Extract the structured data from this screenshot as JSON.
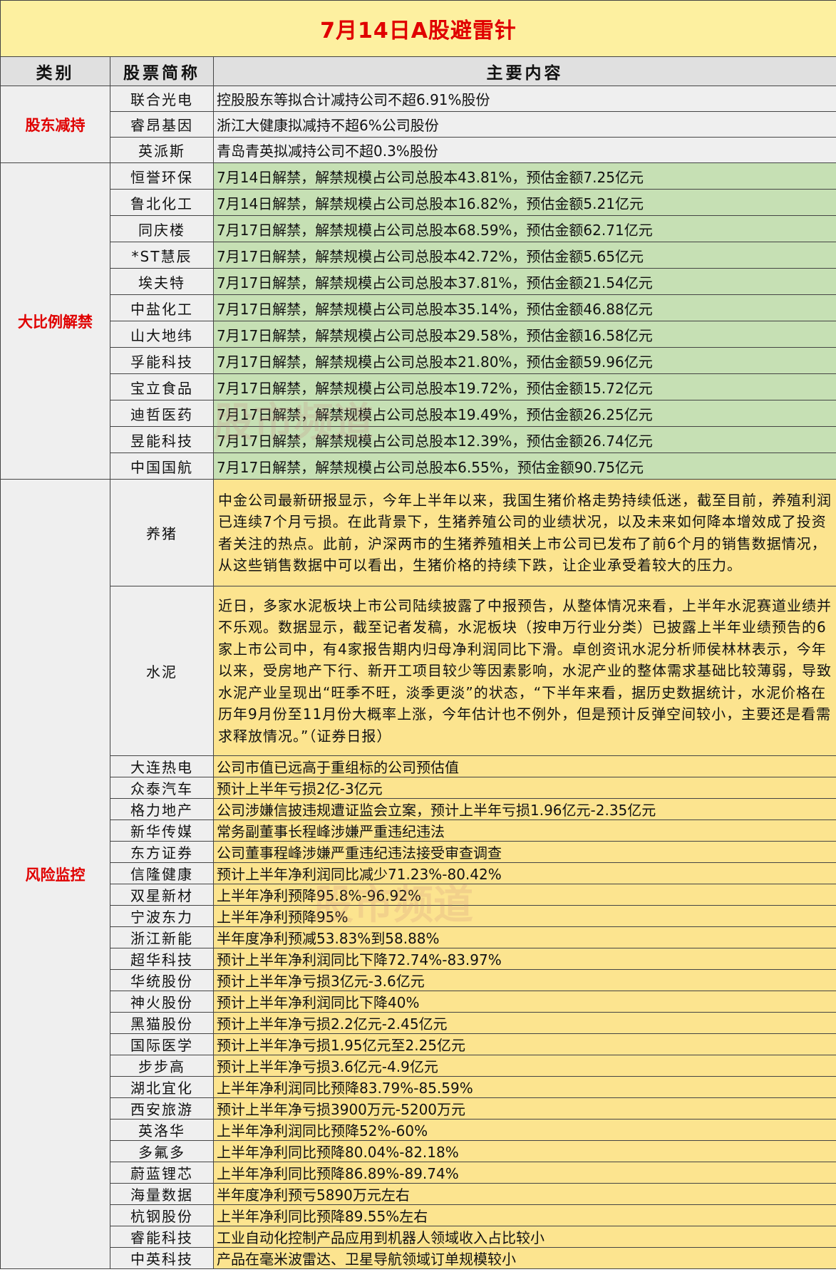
{
  "title": "7月14日A股避雷针",
  "headers": [
    "类别",
    "股票简称",
    "主要内容"
  ],
  "watermark": "股市频道",
  "groups": {
    "shareholder": {
      "category": "股东减持",
      "rows": [
        {
          "name": "联合光电",
          "content": "控股股东等拟合计减持公司不超6.91%股份"
        },
        {
          "name": "睿昂基因",
          "content": "浙江大健康拟减持不超6%公司股份"
        },
        {
          "name": "英派斯",
          "content": "青岛青英拟减持公司不超0.3%股份"
        }
      ]
    },
    "unlock": {
      "category": "大比例解禁",
      "rows": [
        {
          "name": "恒誉环保",
          "content": "7月14日解禁，解禁规模占公司总股本43.81%，预估金额7.25亿元"
        },
        {
          "name": "鲁北化工",
          "content": "7月14日解禁，解禁规模占公司总股本16.82%，预估金额5.21亿元"
        },
        {
          "name": "同庆楼",
          "content": "7月17日解禁，解禁规模占公司总股本68.59%，预估金额62.71亿元"
        },
        {
          "name": "*ST慧辰",
          "content": "7月17日解禁，解禁规模占公司总股本42.72%，预估金额5.65亿元"
        },
        {
          "name": "埃夫特",
          "content": "7月17日解禁，解禁规模占公司总股本37.81%，预估金额21.54亿元"
        },
        {
          "name": "中盐化工",
          "content": "7月17日解禁，解禁规模占公司总股本35.14%，预估金额46.88亿元"
        },
        {
          "name": "山大地纬",
          "content": "7月17日解禁，解禁规模占公司总股本29.58%，预估金额16.58亿元"
        },
        {
          "name": "孚能科技",
          "content": "7月17日解禁，解禁规模占公司总股本21.80%，预估金额59.96亿元"
        },
        {
          "name": "宝立食品",
          "content": "7月17日解禁，解禁规模占公司总股本19.72%，预估金额15.72亿元"
        },
        {
          "name": "迪哲医药",
          "content": "7月17日解禁，解禁规模占公司总股本19.49%，预估金额26.25亿元"
        },
        {
          "name": "昱能科技",
          "content": "7月17日解禁，解禁规模占公司总股本12.39%，预估金额26.74亿元"
        },
        {
          "name": "中国国航",
          "content": "7月17日解禁，解禁规模占公司总股本6.55%，预估金额90.75亿元"
        }
      ]
    },
    "risk": {
      "category": "风险监控",
      "rows": [
        {
          "name": "养猪",
          "content": "中金公司最新研报显示，今年上半年以来，我国生猪价格走势持续低迷，截至目前，养殖利润已连续7个月亏损。在此背景下，生猪养殖公司的业绩状况，以及未来如何降本增效成了投资者关注的热点。此前，沪深两市的生猪养殖相关上市公司已发布了前6个月的销售数据情况，从这些销售数据中可以看出，生猪价格的持续下跌，让企业承受着较大的压力。"
        },
        {
          "name": "水泥",
          "content": "近日，多家水泥板块上市公司陆续披露了中报预告，从整体情况来看，上半年水泥赛道业绩并不乐观。数据显示，截至记者发稿，水泥板块（按申万行业分类）已披露上半年业绩预告的6家上市公司中，有4家报告期内归母净利润同比下滑。卓创资讯水泥分析师侯林林表示，今年以来，受房地产下行、新开工项目较少等因素影响，水泥产业的整体需求基础比较薄弱，导致水泥产业呈现出“旺季不旺，淡季更淡”的状态，“下半年来看，据历史数据统计，水泥价格在历年9月份至11月份大概率上涨，今年估计也不例外，但是预计反弹空间较小，主要还是看需求释放情况。”（证券日报）"
        },
        {
          "name": "大连热电",
          "content": "公司市值已远高于重组标的公司预估值"
        },
        {
          "name": "众泰汽车",
          "content": "预计上半年亏损2亿-3亿元"
        },
        {
          "name": "格力地产",
          "content": "公司涉嫌信披违规遭证监会立案，预计上半年亏损1.96亿元-2.35亿元"
        },
        {
          "name": "新华传媒",
          "content": "常务副董事长程峰涉嫌严重违纪违法"
        },
        {
          "name": "东方证券",
          "content": "公司董事程峰涉嫌严重违纪违法接受审查调查"
        },
        {
          "name": "信隆健康",
          "content": "预计上半年净利润同比减少71.23%-80.42%"
        },
        {
          "name": "双星新材",
          "content": "上半年净利预降95.8%-96.92%"
        },
        {
          "name": "宁波东力",
          "content": "上半年净利预降95%"
        },
        {
          "name": "浙江新能",
          "content": "半年度净利预减53.83%到58.88%"
        },
        {
          "name": "超华科技",
          "content": "预计上半年净利润同比下降72.74%-83.97%"
        },
        {
          "name": "华统股份",
          "content": "预计上半年净亏损3亿元-3.6亿元"
        },
        {
          "name": "神火股份",
          "content": "预计上半年净利润同比下降40%"
        },
        {
          "name": "黑猫股份",
          "content": "预计上半年净亏损2.2亿元-2.45亿元"
        },
        {
          "name": "国际医学",
          "content": "预计上半年净亏损1.95亿元至2.25亿元"
        },
        {
          "name": "步步高",
          "content": "预计上半年净亏损3.6亿元-4.9亿元"
        },
        {
          "name": "湖北宜化",
          "content": "上半年净利润同比预降83.79%-85.59%"
        },
        {
          "name": "西安旅游",
          "content": "预计上半年净亏损3900万元-5200万元"
        },
        {
          "name": "英洛华",
          "content": "上半年净利润同比预降52%-60%"
        },
        {
          "name": "多氟多",
          "content": "上半年净利同比预降80.04%-82.18%"
        },
        {
          "name": "蔚蓝锂芯",
          "content": "上半年净利同比预降86.89%-89.74%"
        },
        {
          "name": "海量数据",
          "content": "半年度净利预亏5890万元左右"
        },
        {
          "name": "杭钢股份",
          "content": "上半年净利同比预降89.55%左右"
        },
        {
          "name": "睿能科技",
          "content": "工业自动化控制产品应用到机器人领域收入占比较小"
        },
        {
          "name": "中英科技",
          "content": "产品在毫米波雷达、卫星导航领域订单规模较小"
        }
      ]
    }
  }
}
